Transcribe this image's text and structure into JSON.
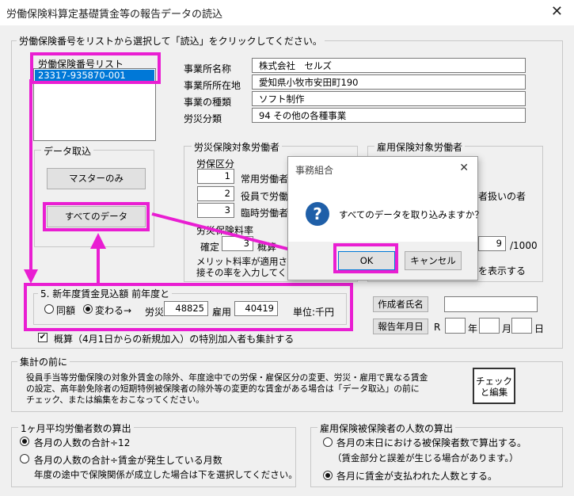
{
  "window": {
    "title": "労働保険料算定基礎賃金等の報告データの読込",
    "close": "✕"
  },
  "main_group": {
    "label": "労働保険番号をリストから選択して「読込」をクリックしてください。"
  },
  "list": {
    "label": "労働保険番号リスト",
    "items": [
      "23317-935870-001"
    ]
  },
  "office": {
    "name_label": "事業所名称",
    "name_value": "株式会社　セルズ",
    "address_label": "事業所所在地",
    "address_value": "愛知県小牧市安田町190",
    "type_label": "事業の種類",
    "type_value": "ソフト制作",
    "class_label": "労災分類",
    "class_value": "94 その他の各種事業"
  },
  "data_import": {
    "label": "データ取込",
    "master_btn": "マスターのみ",
    "all_btn": "すべてのデータ"
  },
  "rousai": {
    "label": "労災保険対象労働者",
    "kubun_label": "労保区分",
    "rows": [
      {
        "num": "1",
        "text": "常用労働者"
      },
      {
        "num": "2",
        "text": "役員で労働"
      },
      {
        "num": "3",
        "text": "臨時労働者"
      }
    ],
    "rate_label": "労災保険料率",
    "kakutei_label": "確定",
    "kakutei_value": "3",
    "gaisan_label": "概算",
    "merit_line1": "メリット料率が適用される",
    "merit_line2": "接その率を入力してくださ"
  },
  "koyou": {
    "label": "雇用保険対象労働者",
    "text1": "者扱いの者",
    "rate_value": "9",
    "rate_unit": "/1000",
    "text2": "を表示する"
  },
  "dialog": {
    "title": "事務組合",
    "close": "✕",
    "icon": "?",
    "message": "すべてのデータを取り込みますか？",
    "ok": "OK",
    "cancel": "キャンセル"
  },
  "forecast": {
    "label": "5. 新年度賃金見込額  前年度と",
    "opt_same": "同額",
    "opt_change": "変わる→",
    "rousai_label": "労災",
    "rousai_value": "48825",
    "koyou_label": "雇用",
    "koyou_value": "40419",
    "unit": "単位:千円"
  },
  "checkbox": {
    "mark": "✔",
    "label": "概算（4月1日からの新規加入）の特別加入者も集計する"
  },
  "author_btn": "作成者氏名",
  "report_btn": "報告年月日",
  "date": {
    "era": "R",
    "year": "年",
    "month": "月",
    "day": "日"
  },
  "notice": {
    "label": "集計の前に",
    "line1": "役員手当等労働保険の対象外賃金の除外、年度途中での労保・雇保区分の変更、労災・雇用で異なる賃金",
    "line2": "の設定、高年齢免除者の短期特例被保険者の除外等の変更的な賃金がある場合は「データ取込」の前に",
    "line3": "チェック、または編集をおこなってください。",
    "btn_line1": "チェック",
    "btn_line2": "と編集"
  },
  "avg": {
    "label": "1ヶ月平均労働者数の算出",
    "opt1": "各月の人数の合計÷12",
    "opt2": "各月の人数の合計÷賃金が発生している月数",
    "note": "年度の途中で保険関係が成立した場合は下を選択してください。"
  },
  "insured": {
    "label": "雇用保険被保険者の人数の算出",
    "opt1": "各月の末日における被保険者数で算出する。",
    "note": "（賃金部分と誤差が生じる場合があります。）",
    "opt2": "各月に賃金が支払われた人数とする。"
  },
  "colors": {
    "highlight": "#e91ed2",
    "selection": "#0078d7",
    "help_icon": "#1f5fa8"
  }
}
